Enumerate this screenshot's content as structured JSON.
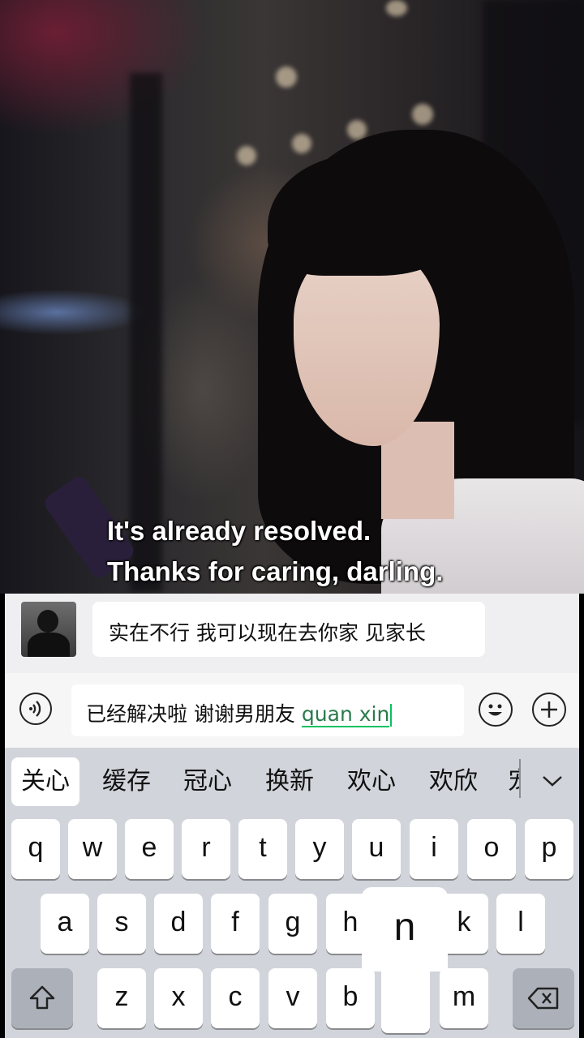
{
  "video": {
    "subtitle_line1": "It's already resolved.",
    "subtitle_line2": "Thanks for caring, darling."
  },
  "chat": {
    "received_message": "实在不行 我可以现在去你家 见家长"
  },
  "input": {
    "committed_text": "已经解决啦 谢谢男朋友 ",
    "composing_pinyin": "quan xin"
  },
  "keyboard": {
    "candidates": [
      "关心",
      "缓存",
      "冠心",
      "换新",
      "欢心",
      "欢欣",
      "宠"
    ],
    "row1": [
      "q",
      "w",
      "e",
      "r",
      "t",
      "y",
      "u",
      "i",
      "o",
      "p"
    ],
    "row2": [
      "a",
      "s",
      "d",
      "f",
      "g",
      "h",
      "k",
      "l"
    ],
    "row3": [
      "z",
      "x",
      "c",
      "v",
      "b",
      "m"
    ],
    "popup_key": "n",
    "icons": {
      "shift": "shift-arrow-icon",
      "backspace": "backspace-icon",
      "expand": "chevron-down-icon",
      "voice": "voice-icon",
      "emoji": "emoji-icon",
      "plus": "plus-icon"
    }
  },
  "colors": {
    "accent_green": "#07c160",
    "keyboard_bg": "#d1d4da",
    "function_key": "#acb1b9"
  }
}
